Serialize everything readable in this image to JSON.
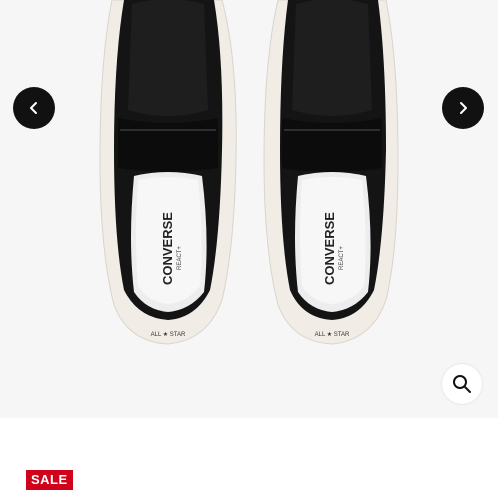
{
  "product": {
    "brand_label": "CONVERSE",
    "insole_sublabel": "REACT+",
    "outsole_label": "ALL ★ STAR"
  },
  "gallery": {
    "prev_icon": "chevron-left-icon",
    "next_icon": "chevron-right-icon",
    "zoom_icon": "search-icon"
  },
  "badge": {
    "sale_label": "SALE",
    "color": "#d0021b"
  },
  "colors": {
    "shoe_upper": "#141414",
    "sole": "#f1ede6",
    "background": "#f6f6f6"
  }
}
